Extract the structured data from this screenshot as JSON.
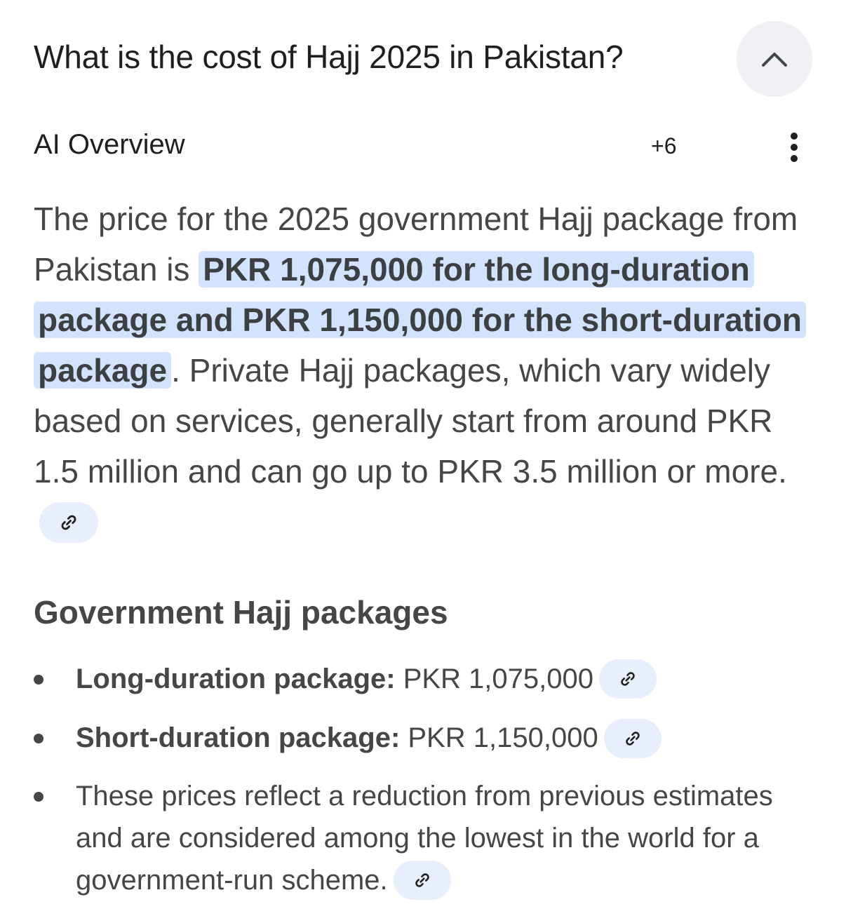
{
  "question": {
    "text": "What is the cost of Hajj 2025 in Pakistan?"
  },
  "ai_overview": {
    "title": "AI Overview",
    "source_count": "+6"
  },
  "summary": {
    "intro": "The price for the 2025 government Hajj package from Pakistan is ",
    "highlight": "PKR 1,075,000 for the long-duration package and PKR 1,150,000 for the short-duration package",
    "rest": ". Private Hajj packages, which vary widely based on services, generally start from around PKR 1.5 million and can go up to PKR 3.5 million or more."
  },
  "section": {
    "heading": "Government Hajj packages",
    "bullets": [
      {
        "label": "Long-duration package:",
        "text": " PKR 1,075,000"
      },
      {
        "label": "Short-duration package:",
        "text": " PKR 1,150,000"
      },
      {
        "label": "",
        "text": "These prices reflect a reduction from previous estimates and are considered among the lowest in the world for a government-run scheme."
      }
    ]
  },
  "icons": {
    "collapse": "chevron-up-icon",
    "more": "more-vert-icon",
    "link": "link-icon"
  },
  "colors": {
    "highlight_bg": "#d3e3fd",
    "chip_bg": "#e8eefb",
    "collapse_bg": "#eef0f3",
    "body_text": "#444746",
    "title_text": "#1f1f1f"
  }
}
